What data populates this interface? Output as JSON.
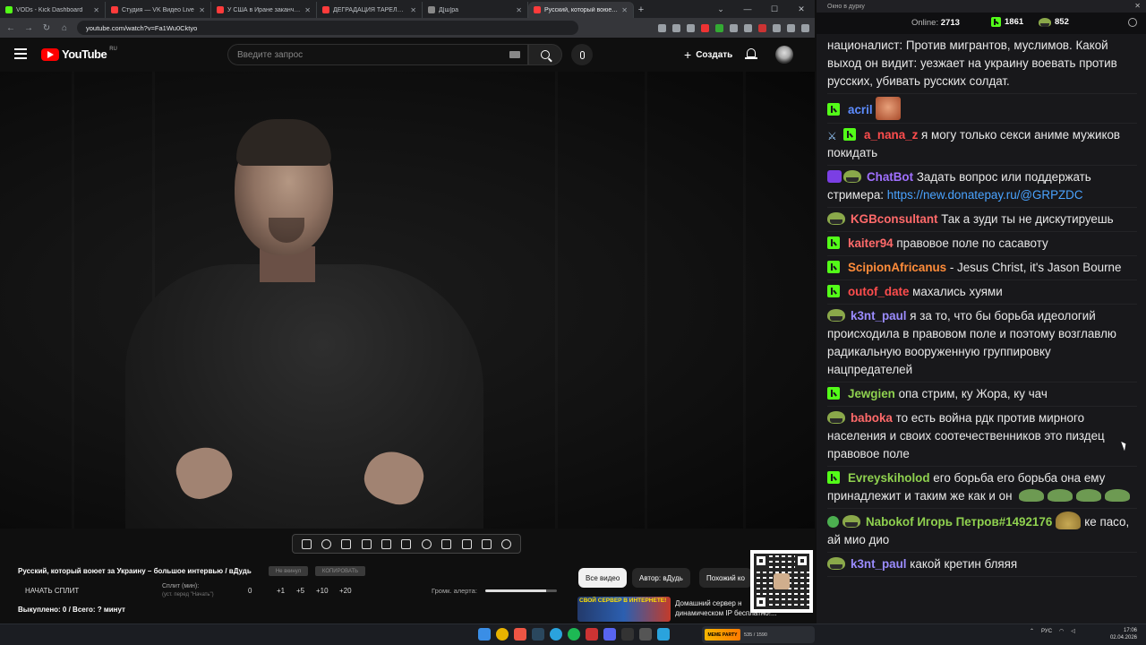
{
  "browser": {
    "tabs": [
      {
        "title": "VODs - Kick Dashboard",
        "fav": "#53fc18"
      },
      {
        "title": "Студия — VK Видео Live",
        "fav": "#ff3b3b"
      },
      {
        "title": "У США в Иране заканчиваются",
        "fav": "#ff3b3b"
      },
      {
        "title": "ДЕГРАДАЦИЯ ТАРЕЛОЧНИЦ",
        "fav": "#ff3b3b"
      },
      {
        "title": "Д[ш]ра",
        "fav": "#888888"
      },
      {
        "title": "Русский, который воюет з",
        "fav": "#ff3b3b"
      }
    ],
    "new_tab": "+",
    "url": "youtube.com/watch?v=Fa1Wu0Cktyo"
  },
  "youtube": {
    "logo_text": "YouTube",
    "region": "RU",
    "search_placeholder": "Введите запрос",
    "create_label": "Создать",
    "create_plus": "+"
  },
  "overlay": {
    "title": "Русский, который воюет за Украину – большое интервью / вДудь",
    "pill1": "Не вкинул",
    "pill2": "КОПИРОВАТЬ",
    "start_split": "НАЧАТЬ СПЛИТ",
    "split_label": "Сплит (мин):",
    "split_hint": "(уст. перед \"Начать\")",
    "split_values": [
      "0",
      "+1",
      "+5",
      "+10",
      "+20"
    ],
    "volume_label": "Громк. алерта:",
    "volume_level": 0.85,
    "bought": "Выкуплено: 0 / Всего: ? минут"
  },
  "recommend": {
    "chips": [
      "Все видео",
      "Автор: вДудь",
      "Похожий ко"
    ],
    "thumb_text": "СВОЙ СЕРВЕР В ИНТЕРНЕТЕ!",
    "rec_line1": "Домашний сервер н",
    "rec_line2": "динамическом IP бесплатно!..."
  },
  "chat": {
    "window_title": "Окно в дурку",
    "online_label": "Online:",
    "online_count": "2713",
    "kick_count": "1861",
    "other_count": "852",
    "messages": [
      {
        "text": "националист: Против мигрантов, муслимов. Какой выход он видит: уезжает на украину воевать против русских, убивать русских солдат."
      },
      {
        "name": "acril",
        "color": "#5d8cff",
        "badges": "k",
        "text": "",
        "emote": true
      },
      {
        "name": "a_nana_z",
        "color": "#ff4d4d",
        "badges": "sk",
        "text": "я могу только секси аниме мужиков покидать"
      },
      {
        "name": "ChatBot",
        "color": "#a070ff",
        "badges": "rf",
        "text": "Задать вопрос или поддержать стримера: ",
        "link": "https://new.donatepay.ru/@GRPZDC"
      },
      {
        "name": "KGBconsultant",
        "color": "#ff6a6a",
        "badges": "f",
        "text": "Так а зуди ты не дискутируешь"
      },
      {
        "name": "kaiter94",
        "color": "#ff6a6a",
        "badges": "k",
        "text": "правовое поле по сасавоту"
      },
      {
        "name": "ScipionAfricanus",
        "color": "#ff8c3a",
        "badges": "k",
        "text": "- Jesus Christ, it's Jason Bourne"
      },
      {
        "name": "outof_date",
        "color": "#ff4d4d",
        "badges": "k",
        "text": "махались хуями"
      },
      {
        "name": "k3nt_paul",
        "color": "#9b8cff",
        "badges": "f",
        "text": "я за то, что бы борьба идеологий происходила в правовом поле и поэтому возглавлю радикальную вооруженную группировку нацпредателей"
      },
      {
        "name": "Jewgien",
        "color": "#8fd14f",
        "badges": "k",
        "text": "опа стрим, ку Жора, ку чач"
      },
      {
        "name": "baboka",
        "color": "#ff6a6a",
        "badges": "f",
        "text": "то есть война рдк против мирного населения и своих соотечественников это пиздец правовое поле"
      },
      {
        "name": "Evreyskiholod",
        "color": "#8fd14f",
        "badges": "k",
        "text": "его борьба его борьба она ему принадлежит и таким же как и он",
        "emotes2": 4
      },
      {
        "name": "Nabokof",
        "color": "#8fd14f",
        "badges": "sf",
        "text": "ке пасо, ай мио дио",
        "mention": "Игорь Петров#1492176"
      },
      {
        "name": "k3nt_paul",
        "color": "#9b8cff",
        "badges": "f",
        "text": "какой кретин бляяя"
      }
    ]
  },
  "taskbar": {
    "tile_title": "MEME PARTY",
    "tile_sub": "535 / 1590",
    "lang": "РУС",
    "time": "17:06",
    "date": "02.04.2026"
  }
}
